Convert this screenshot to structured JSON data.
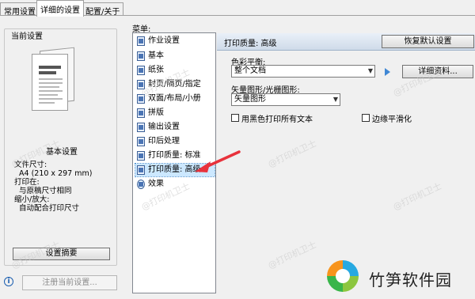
{
  "tabs": [
    {
      "label": "常用设置"
    },
    {
      "label": "详细的设置"
    },
    {
      "label": "配置/关于"
    }
  ],
  "current_settings": {
    "group_title": "当前设置",
    "mid_title": "基本设置",
    "details": [
      "文件尺寸:",
      "A4 (210 x 297 mm)",
      "打印在:",
      "与原稿尺寸相同",
      "缩小/放大:",
      "自动配合打印尺寸"
    ],
    "summary_button": "设置摘要",
    "register_button": "注册当前设置..."
  },
  "menu": {
    "label": "菜单:",
    "items": [
      {
        "label": "作业设置"
      },
      {
        "label": "基本"
      },
      {
        "label": "纸张"
      },
      {
        "label": "封页/隔页/指定"
      },
      {
        "label": "双面/布局/小册"
      },
      {
        "label": "拼版"
      },
      {
        "label": "输出设置"
      },
      {
        "label": "印后处理"
      },
      {
        "label": "打印质量: 标准"
      },
      {
        "label": "打印质量: 高级"
      },
      {
        "label": "效果"
      }
    ]
  },
  "panel": {
    "title": "打印质量: 高级",
    "restore_button": "恢复默认设置",
    "color_balance_label": "色彩平衡:",
    "color_balance_value": "整个文档",
    "detail_button": "详细资料...",
    "vector_label": "矢量图形/光栅图形:",
    "vector_value": "矢量图形",
    "checkbox_black_text": "用黑色打印所有文本",
    "checkbox_edge_smooth": "边缘平滑化"
  },
  "watermark": {
    "text": "@打印机卫士"
  },
  "logo": {
    "text": "竹笋软件园"
  },
  "colors": {
    "accent": "#3f87d4",
    "selected": "#cce8ff",
    "arrow": "#e8323c"
  }
}
